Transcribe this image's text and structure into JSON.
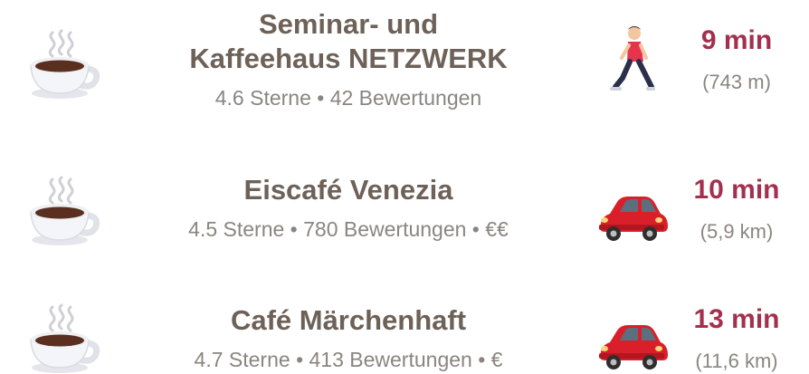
{
  "results": [
    {
      "name_lines": [
        "Seminar- und",
        "Kaffeehaus NETZWERK"
      ],
      "meta": "4.6 Sterne • 42 Bewertungen",
      "mode_icon": "walking-person-icon",
      "time": "9 min",
      "distance": "(743 m)"
    },
    {
      "name_lines": [
        "Eiscafé Venezia"
      ],
      "meta": "4.5 Sterne • 780 Bewertungen • €€",
      "mode_icon": "car-icon",
      "time": "10 min",
      "distance": "(5,9 km)"
    },
    {
      "name_lines": [
        "Café Märchenhaft"
      ],
      "meta": "4.7 Sterne • 413 Bewertungen • €",
      "mode_icon": "car-icon",
      "time": "13 min",
      "distance": "(11,6 km)"
    }
  ],
  "colors": {
    "name": "#6d6158",
    "meta": "#8b8580",
    "time": "#a3304f"
  }
}
